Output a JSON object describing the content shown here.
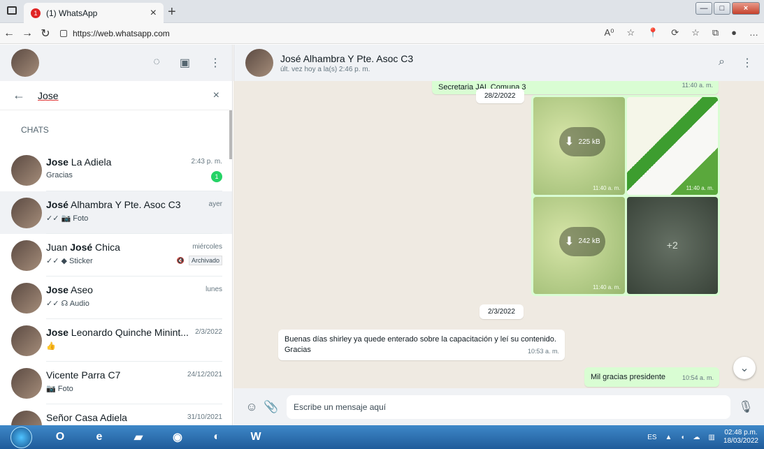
{
  "browser": {
    "tab_title": "(1) WhatsApp",
    "tab_notification": "1",
    "url": "https://web.whatsapp.com",
    "tools": [
      "A⁰",
      "☆",
      "📍",
      "⟳",
      "☆",
      "⧉",
      "●",
      "…"
    ]
  },
  "left_panel": {
    "search_value": "Jose",
    "section_title": "CHATS",
    "chats": [
      {
        "name_prefix": "",
        "name_bold": "Jose",
        "name_rest": " La Adiela",
        "time": "2:43 p. m.",
        "preview": "Gracias",
        "badge": "1"
      },
      {
        "name_prefix": "",
        "name_bold": "José",
        "name_rest": " Alhambra Y Pte. Asoc C3",
        "time": "ayer",
        "preview": "✓✓ 📷 Foto"
      },
      {
        "name_prefix": "Juan ",
        "name_bold": "José",
        "name_rest": " Chica",
        "time": "miércoles",
        "preview": "✓✓ ◆ Sticker",
        "archived": "Archivado"
      },
      {
        "name_prefix": "",
        "name_bold": "Jose",
        "name_rest": " Aseo",
        "time": "lunes",
        "preview": "✓✓ ☊ Audio"
      },
      {
        "name_prefix": "",
        "name_bold": "Jose",
        "name_rest": " Leonardo Quinche Minint...",
        "time": "2/3/2022",
        "preview": "👍"
      },
      {
        "name_prefix": "Vicente Parra C7",
        "name_bold": "",
        "name_rest": "",
        "time": "24/12/2021",
        "preview": "📷 Foto"
      },
      {
        "name_prefix": "Señor Casa Adiela",
        "name_bold": "",
        "name_rest": "",
        "time": "31/10/2021",
        "preview": ""
      }
    ]
  },
  "conversation": {
    "title": "José Alhambra Y Pte. Asoc C3",
    "status": "últ. vez hoy a la(s) 2:46 p. m.",
    "top_message": {
      "text": "Secretaria JAL Comuna 3",
      "time": "11:40 a. m."
    },
    "date_1": "28/2/2022",
    "media": [
      {
        "label": "225 kB",
        "time": "11:40 a. m."
      },
      {
        "label": "",
        "time": "11:40 a. m."
      },
      {
        "label": "242 kB",
        "time": "11:40 a. m."
      },
      {
        "label": "+2",
        "time": ""
      }
    ],
    "date_2": "2/3/2022",
    "incoming": {
      "text": "Buenas días shirley ya quede enterado sobre la capacitación y leí su contenido. Gracias",
      "time": "10:53 a. m."
    },
    "outgoing": {
      "text": "Mil gracias presidente",
      "time": "10:54 a. m."
    },
    "composer_placeholder": "Escribe un mensaje aquí"
  },
  "taskbar": {
    "language": "ES",
    "time": "02:48 p.m.",
    "date": "18/03/2022"
  },
  "colors": {
    "whatsapp_green": "#25d366",
    "outgoing_bubble": "#d9fdd3",
    "chat_background": "#efeae2"
  }
}
